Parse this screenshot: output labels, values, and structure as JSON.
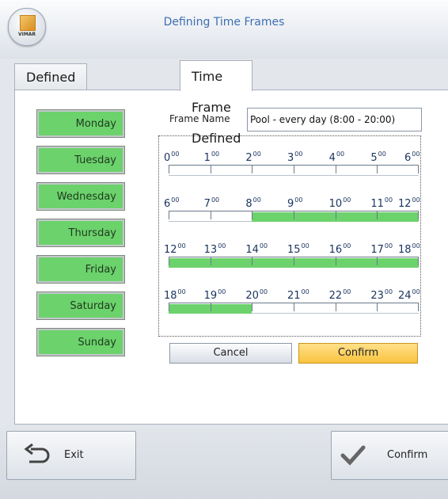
{
  "window": {
    "title": "Defining Time Frames",
    "logo_text": "VIMAR"
  },
  "tabs": [
    {
      "label": "Defined Time Frames",
      "active": false
    },
    {
      "label": "Time Frame Defined",
      "active": true
    }
  ],
  "days": [
    "Monday",
    "Tuesday",
    "Wednesday",
    "Thursday",
    "Friday",
    "Saturday",
    "Sunday"
  ],
  "frame": {
    "label": "Frame Name",
    "value": "Pool - every day (8:00 - 20:00)"
  },
  "timeline": {
    "rows": [
      {
        "hours": [
          "0",
          "1",
          "2",
          "3",
          "4",
          "5",
          "6"
        ],
        "active_from": null,
        "active_to": null
      },
      {
        "hours": [
          "6",
          "7",
          "8",
          "9",
          "10",
          "11",
          "12"
        ],
        "active_from": 8,
        "active_to": 12
      },
      {
        "hours": [
          "12",
          "13",
          "14",
          "15",
          "16",
          "17",
          "18"
        ],
        "active_from": 12,
        "active_to": 18
      },
      {
        "hours": [
          "18",
          "19",
          "20",
          "21",
          "22",
          "23",
          "24"
        ],
        "active_from": 18,
        "active_to": 20
      }
    ],
    "minute_suffix": "00",
    "active_color": "#6cd26c"
  },
  "buttons": {
    "cancel": "Cancel",
    "confirm": "Confirm"
  },
  "footer": {
    "exit": "Exit",
    "confirm": "Confirm",
    "exit_icon": "undo-arrow-icon",
    "confirm_icon": "checkmark-icon"
  }
}
